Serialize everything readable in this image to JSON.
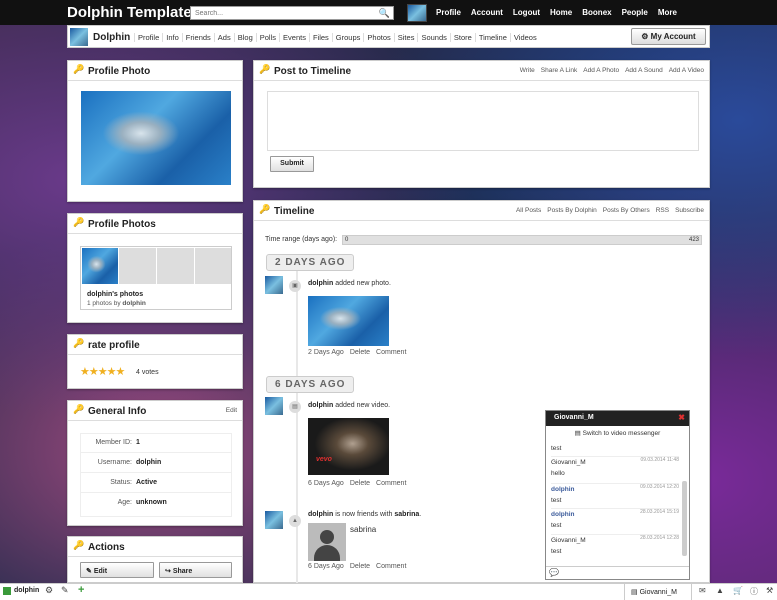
{
  "header": {
    "logo": "Dolphin Template",
    "search_placeholder": "Search...",
    "nav": [
      "Profile",
      "Account",
      "Logout",
      "Home",
      "Boonex",
      "People",
      "More"
    ]
  },
  "subnav": {
    "name": "Dolphin",
    "links": [
      "Profile",
      "Info",
      "Friends",
      "Ads",
      "Blog",
      "Polls",
      "Events",
      "Files",
      "Groups",
      "Photos",
      "Sites",
      "Sounds",
      "Store",
      "Timeline",
      "Videos"
    ],
    "my_account": "My Account"
  },
  "profile_photo": {
    "title": "Profile Photo"
  },
  "profile_photos": {
    "title": "Profile Photos",
    "album_name": "dolphin's photos",
    "album_count": "1 photos by",
    "album_owner": "dolphin"
  },
  "rate": {
    "title": "rate profile",
    "stars": 5,
    "votes": "4 votes"
  },
  "general_info": {
    "title": "General Info",
    "edit": "Edit",
    "rows": [
      {
        "key": "Member ID:",
        "value": "1"
      },
      {
        "key": "Username:",
        "value": "dolphin"
      },
      {
        "key": "Status:",
        "value": "Active"
      },
      {
        "key": "Age:",
        "value": "unknown"
      }
    ]
  },
  "actions": {
    "title": "Actions",
    "edit": "Edit",
    "share": "Share"
  },
  "post": {
    "title": "Post to Timeline",
    "tools": [
      "Write",
      "Share A Link",
      "Add A Photo",
      "Add A Sound",
      "Add A Video"
    ],
    "submit": "Submit"
  },
  "timeline": {
    "title": "Timeline",
    "filters": [
      "All Posts",
      "Posts By Dolphin",
      "Posts By Others",
      "RSS",
      "Subscribe"
    ],
    "range_label": "Time range (days ago):",
    "range_min": "0",
    "range_max": "423",
    "groups": [
      {
        "label": "2 DAYS AGO"
      },
      {
        "label": "6 DAYS AGO"
      }
    ],
    "entries": [
      {
        "user": "dolphin",
        "action": "added new photo.",
        "meta": [
          "2 Days Ago",
          "Delete",
          "Comment"
        ]
      },
      {
        "user": "dolphin",
        "action": "added new video.",
        "meta": [
          "6 Days Ago",
          "Delete",
          "Comment"
        ],
        "video_brand": "vevo"
      },
      {
        "user": "dolphin",
        "action": "is now friends with",
        "friend": "sabrina",
        "friend_label": "sabrina",
        "meta": [
          "6 Days Ago",
          "Delete",
          "Comment"
        ]
      }
    ]
  },
  "chat": {
    "user": "Giovanni_M",
    "switch": "Switch to video messenger",
    "messages": [
      {
        "name": "",
        "time": "",
        "text": "test"
      },
      {
        "name": "Giovanni_M",
        "time": "09.03.2014 11:48",
        "text": "hello"
      },
      {
        "name": "dolphin",
        "time": "09.03.2014 12:20",
        "text": "test"
      },
      {
        "name": "dolphin",
        "time": "28.03.2014 15:19",
        "text": "test"
      },
      {
        "name": "Giovanni_M",
        "time": "28.03.2014 12:28",
        "text": "test"
      }
    ]
  },
  "bottombar": {
    "user": "dolphin",
    "chat_tab": "Giovanni_M"
  },
  "colors": {
    "accent": "#e0a020",
    "topbar": "#111111",
    "link": "#3a5a9a"
  }
}
